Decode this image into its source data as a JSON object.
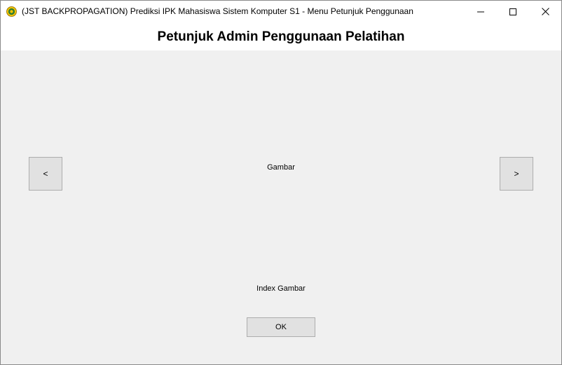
{
  "window": {
    "title": "(JST BACKPROPAGATION) Prediksi IPK Mahasiswa Sistem Komputer S1 - Menu Petunjuk Penggunaan",
    "icon": "university-seal-icon",
    "controls": {
      "minimize_icon": "minimize-icon",
      "maximize_icon": "maximize-icon",
      "close_icon": "close-icon"
    }
  },
  "header": {
    "title": "Petunjuk Admin Penggunaan Pelatihan"
  },
  "viewer": {
    "prev_label": "<",
    "next_label": ">",
    "image_label": "Gambar",
    "index_label": "Index Gambar"
  },
  "footer": {
    "ok_label": "OK"
  },
  "colors": {
    "window_bg": "#f0f0f0",
    "titlebar_bg": "#ffffff",
    "button_bg": "#e1e1e1",
    "button_border": "#adadad",
    "seal_green": "#2e7d32",
    "seal_yellow": "#f2c200"
  }
}
